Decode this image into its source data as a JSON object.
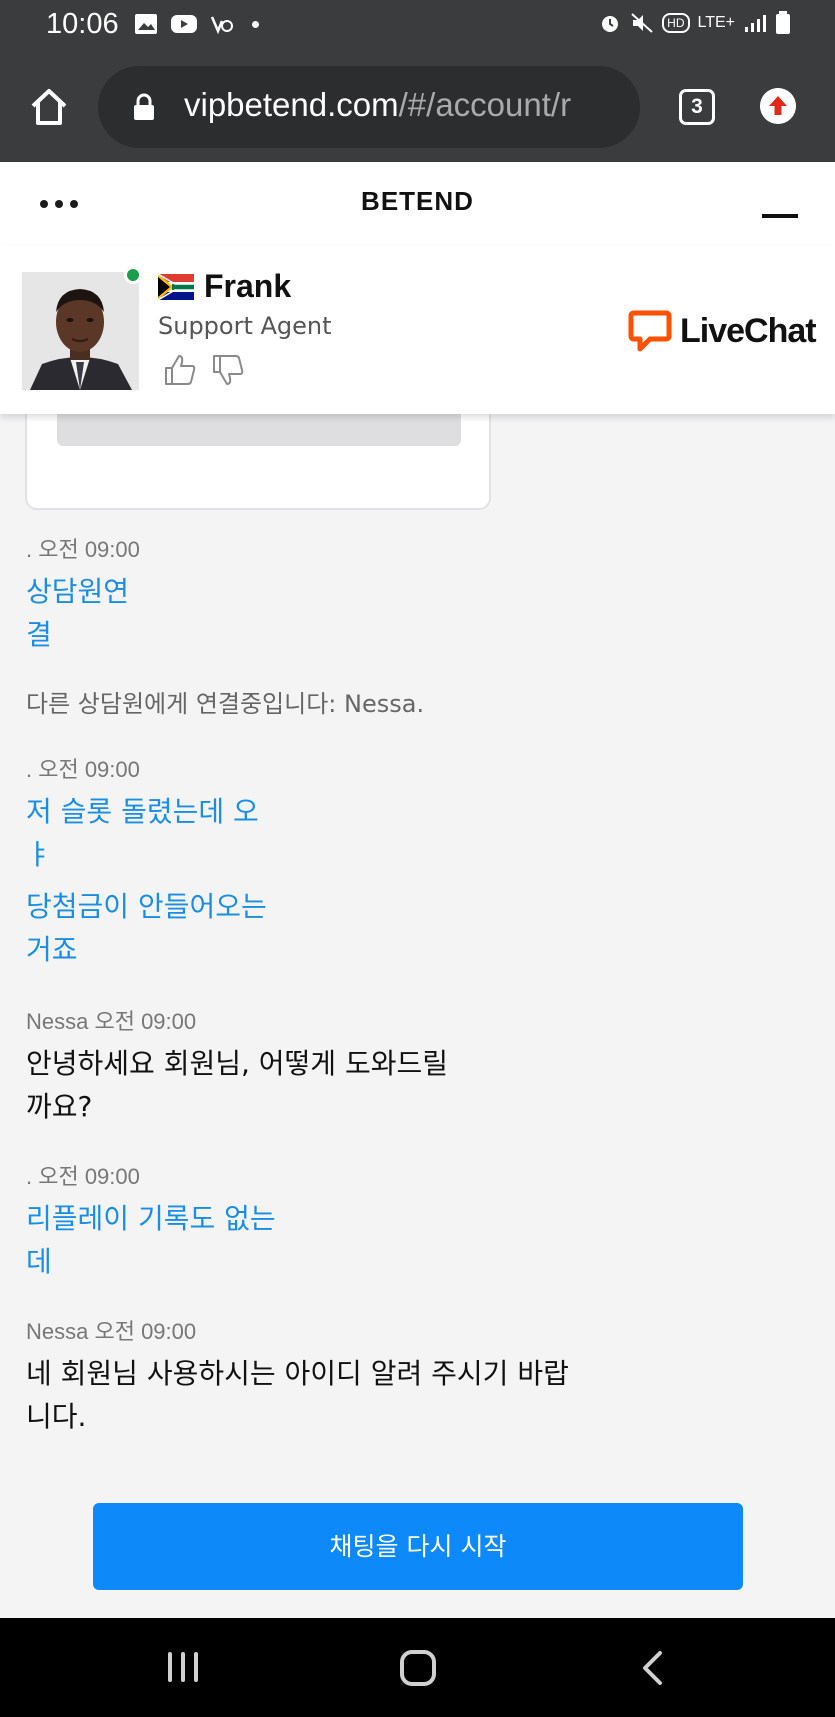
{
  "status_bar": {
    "time": "10:06",
    "network": "LTE+",
    "hd": "HD"
  },
  "browser": {
    "url_host": "vipbetend.com",
    "url_path": "/#/account/r",
    "tab_count": "3"
  },
  "chat_header": {
    "title": "BETEND"
  },
  "agent": {
    "name": "Frank",
    "role": "Support Agent",
    "status_color": "#1a9e49"
  },
  "brand": {
    "name": "LiveChat",
    "color": "#ff5100"
  },
  "messages": [
    {
      "type": "user",
      "meta": ". 오전 09:00",
      "lines": [
        "상담원연",
        "결"
      ]
    },
    {
      "type": "system",
      "text": "다른 상담원에게 연결중입니다: Nessa."
    },
    {
      "type": "user",
      "meta": ". 오전 09:00",
      "lines": [
        "저 슬롯 돌렸는데 오",
        "ㅑ",
        "당첨금이 안들어오는",
        "거죠"
      ]
    },
    {
      "type": "agent",
      "meta": "Nessa 오전 09:00",
      "lines": [
        "안녕하세요 회원님, 어떻게 도와드릴",
        "까요?"
      ]
    },
    {
      "type": "user",
      "meta": ". 오전 09:00",
      "lines": [
        "리플레이 기록도 없는",
        "데"
      ]
    },
    {
      "type": "agent",
      "meta": "Nessa 오전 09:00",
      "lines": [
        "네 회원님 사용하시는 아이디 알려 주시기 바랍",
        "니다."
      ]
    }
  ],
  "restart_button": {
    "label": "채팅을 다시 시작",
    "color": "#0e89fa"
  }
}
